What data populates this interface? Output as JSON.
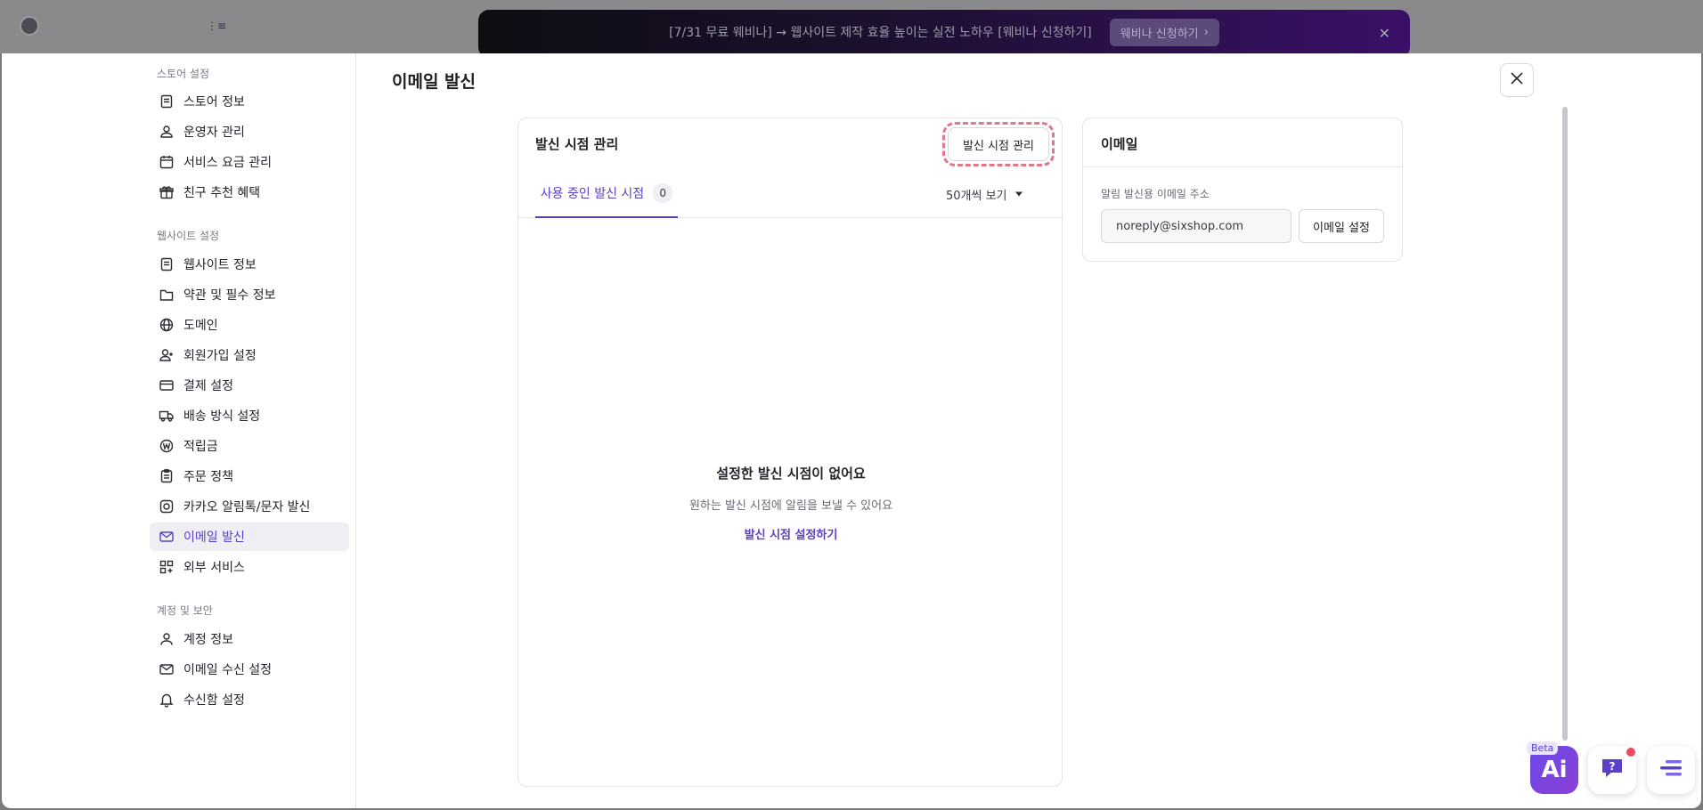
{
  "banner": {
    "text": "[7/31 무료 웨비나] → 웹사이트 제작 효율 높이는 실전 노하우 [웨비나 신청하기]",
    "button_label": "웨비나 신청하기",
    "close_glyph": "✕"
  },
  "sidebar": {
    "groups": [
      {
        "label": "스토어 설정",
        "items": [
          "스토어 정보",
          "운영자 관리",
          "서비스 요금 관리",
          "친구 추천 혜택"
        ]
      },
      {
        "label": "웹사이트 설정",
        "items": [
          "웹사이트 정보",
          "약관 및 필수 정보",
          "도메인",
          "회원가입 설정",
          "결제 설정",
          "배송 방식 설정",
          "적립금",
          "주문 정책",
          "카카오 알림톡/문자 발신",
          "이메일 발신",
          "외부 서비스"
        ]
      },
      {
        "label": "계정 및 보안",
        "items": [
          "계정 정보",
          "이메일 수신 설정",
          "수신함 설정"
        ]
      }
    ],
    "active_item": "이메일 발신"
  },
  "page": {
    "title": "이메일 발신"
  },
  "send_timing": {
    "title": "발신 시점 관리",
    "manage_button": "발신 시점 관리",
    "tab_label": "사용 중인 발신 시점",
    "tab_count": "0",
    "per_page": "50개씩 보기",
    "empty_title": "설정한 발신 시점이 없어요",
    "empty_desc": "원하는 발신 시점에 알림을 보낼 수 있어요",
    "empty_link": "발신 시점 설정하기"
  },
  "email_card": {
    "title": "이메일",
    "field_label": "알림 발신용 이메일 주소",
    "email_value": "noreply@sixshop.com",
    "settings_button": "이메일 설정"
  },
  "fabs": {
    "ai_label": "Ai",
    "beta_label": "Beta"
  },
  "colors": {
    "accent": "#5b3fc9",
    "highlight_dashed": "#e0788c",
    "notification_dot": "#e84a5f"
  }
}
